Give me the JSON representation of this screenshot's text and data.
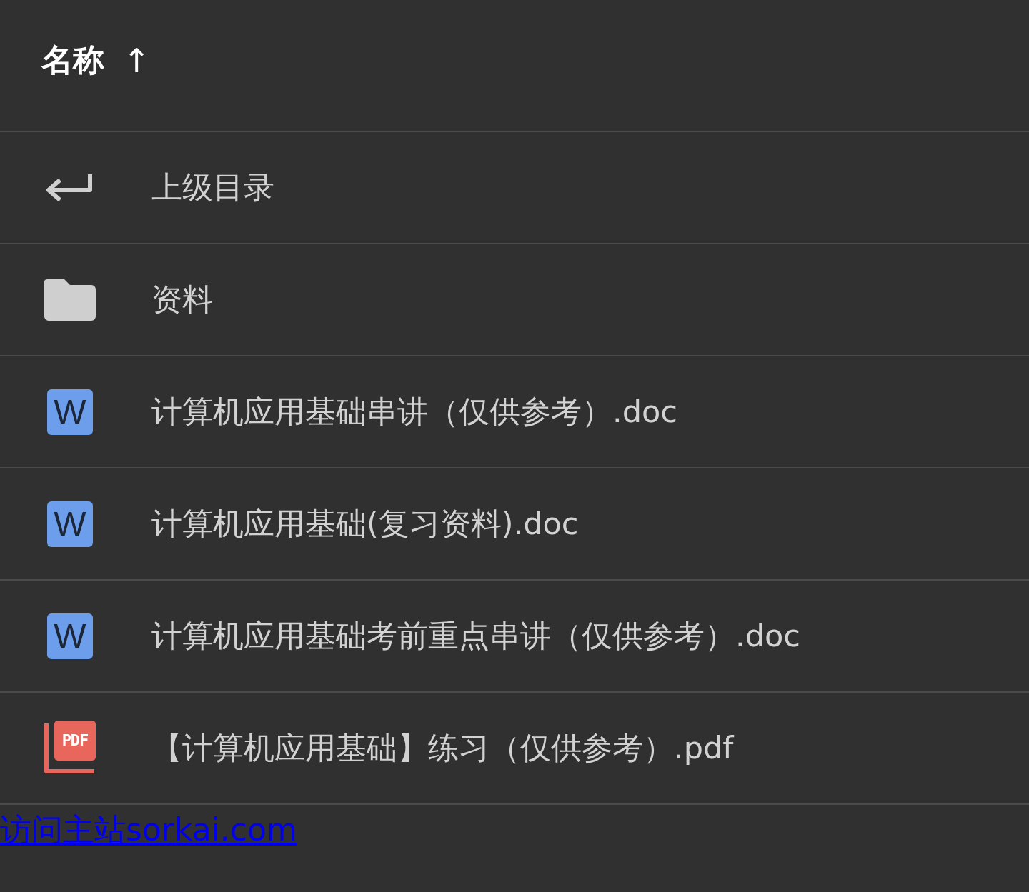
{
  "header": {
    "label": "名称",
    "sort_arrow": "↑"
  },
  "rows": [
    {
      "kind": "parent",
      "name": "上级目录"
    },
    {
      "kind": "folder",
      "name": "资料"
    },
    {
      "kind": "doc",
      "badge": "W",
      "name": "计算机应用基础串讲（仅供参考）.doc"
    },
    {
      "kind": "doc",
      "badge": "W",
      "name": "计算机应用基础(复习资料).doc"
    },
    {
      "kind": "doc",
      "badge": "W",
      "name": "计算机应用基础考前重点串讲（仅供参考）.doc"
    },
    {
      "kind": "pdf",
      "badge": "PDF",
      "name": "【计算机应用基础】练习（仅供参考）.pdf"
    }
  ],
  "link": {
    "text": "访问主站sorkai.com"
  }
}
